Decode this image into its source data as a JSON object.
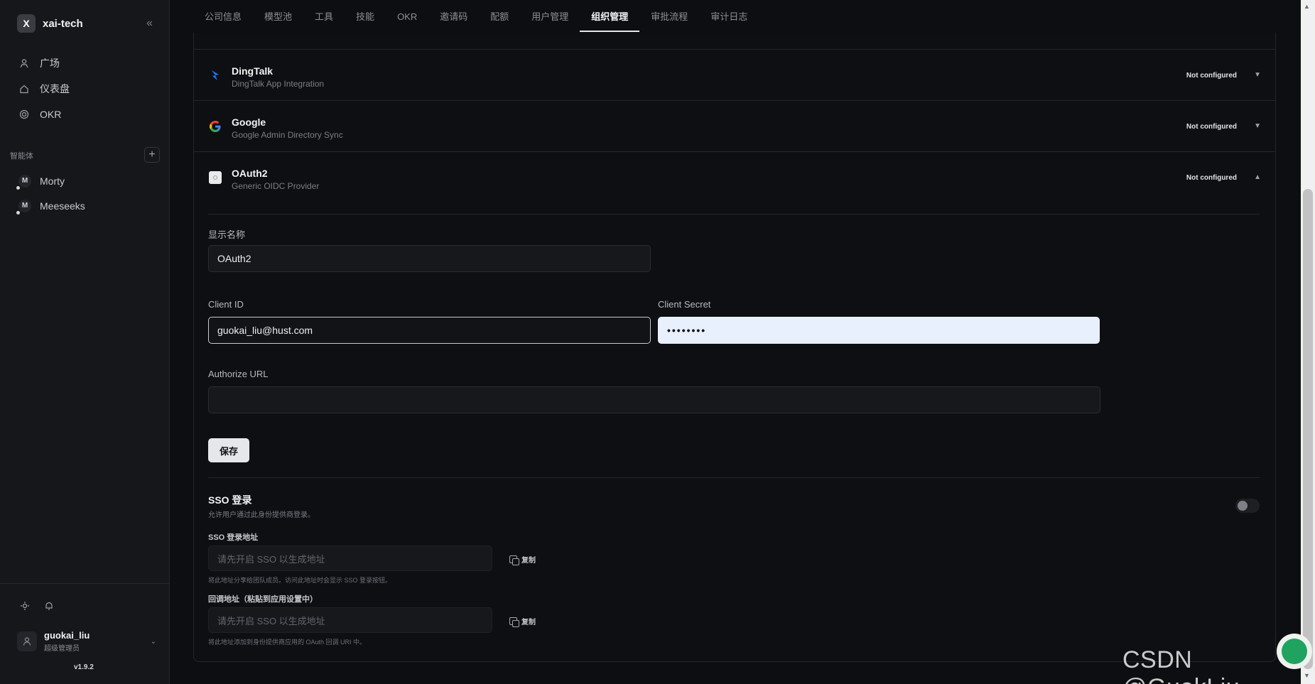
{
  "brand": {
    "logo_letter": "X",
    "name": "xai-tech"
  },
  "nav": [
    {
      "label": "广场",
      "icon": "person-icon"
    },
    {
      "label": "仪表盘",
      "icon": "home-icon"
    },
    {
      "label": "OKR",
      "icon": "target-icon"
    }
  ],
  "agents_section": {
    "title": "智能体",
    "add": "+"
  },
  "agents": [
    {
      "initial": "M",
      "name": "Morty"
    },
    {
      "initial": "M",
      "name": "Meeseeks"
    }
  ],
  "user": {
    "name": "guokai_liu",
    "role": "超级管理员",
    "version": "v1.9.2"
  },
  "tabs": [
    "公司信息",
    "模型池",
    "工具",
    "技能",
    "OKR",
    "邀请码",
    "配额",
    "用户管理",
    "组织管理",
    "审批流程",
    "审计日志"
  ],
  "active_tab": "组织管理",
  "providers": [
    {
      "name": "DingTalk",
      "desc": "DingTalk App Integration",
      "status": "Not configured",
      "expanded": false
    },
    {
      "name": "Google",
      "desc": "Google Admin Directory Sync",
      "status": "Not configured",
      "expanded": false
    },
    {
      "name": "OAuth2",
      "desc": "Generic OIDC Provider",
      "status": "Not configured",
      "expanded": true
    }
  ],
  "form": {
    "display_name_label": "显示名称",
    "display_name_value": "OAuth2",
    "client_id_label": "Client ID",
    "client_id_value": "guokai_liu@hust.com",
    "client_secret_label": "Client Secret",
    "client_secret_value": "••••••••",
    "authorize_url_label": "Authorize URL",
    "authorize_url_value": "",
    "save_label": "保存"
  },
  "sso": {
    "title": "SSO 登录",
    "desc": "允许用户通过此身份提供商登录。",
    "enabled": false,
    "login_url_label": "SSO 登录地址",
    "login_url_placeholder": "请先开启 SSO 以生成地址",
    "login_url_hint": "将此地址分享给团队成员。访问此地址时会显示 SSO 登录按钮。",
    "callback_label": "回调地址（粘贴到应用设置中）",
    "callback_placeholder": "请先开启 SSO 以生成地址",
    "callback_hint": "将此地址添加到身份提供商应用的 OAuth 回调 URI 中。",
    "copy_label": "复制"
  },
  "watermark": "CSDN @GuokLiu",
  "colors": {
    "bg": "#0d0e11",
    "sidebar": "#16171b",
    "accent": "#e6e7ea",
    "dingtalk": "#1677ff"
  }
}
